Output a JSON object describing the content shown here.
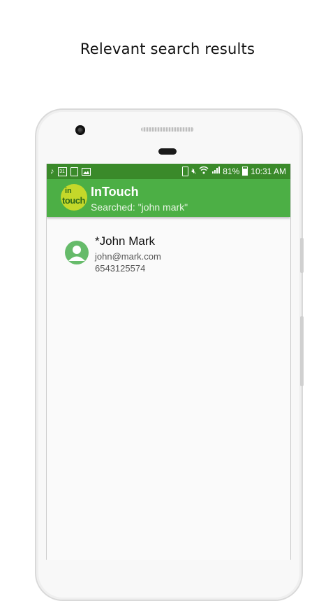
{
  "caption": "Relevant search results",
  "status_bar": {
    "battery_percent": "81%",
    "time": "10:31 AM",
    "calendar_day": "31",
    "icons_left": [
      "music-icon",
      "calendar-icon",
      "clipboard-icon",
      "image-icon"
    ],
    "icons_right": [
      "battery-saver-icon",
      "mute-icon",
      "wifi-icon",
      "signal-icon",
      "battery-icon"
    ]
  },
  "app": {
    "logo_top": "in",
    "logo_bottom": "touch",
    "title": "InTouch",
    "subtitle": "Searched: \"john mark\"",
    "colors": {
      "status_bar": "#3a8a2a",
      "app_bar": "#4caf45",
      "logo": "#c4d82a",
      "avatar": "#66bb6a"
    }
  },
  "results": [
    {
      "name": "*John Mark",
      "email": "john@mark.com",
      "phone": "6543125574"
    }
  ]
}
